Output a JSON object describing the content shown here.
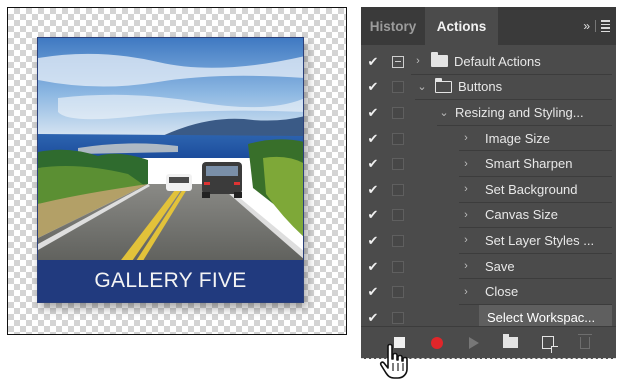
{
  "artwork": {
    "caption": "GALLERY FIVE",
    "band_color": "#213a7e"
  },
  "panel": {
    "tabs": [
      {
        "label": "History",
        "active": false
      },
      {
        "label": "Actions",
        "active": true
      }
    ],
    "menu_overflow": "»",
    "rows": [
      {
        "label": "Default Actions",
        "checked": true,
        "dialog_toggle": true,
        "expanded": false,
        "kind": "set",
        "indent": 0
      },
      {
        "label": "Buttons",
        "checked": true,
        "dialog_toggle": false,
        "expanded": true,
        "kind": "set",
        "indent": 0
      },
      {
        "label": "Resizing and Styling...",
        "checked": true,
        "dialog_toggle": false,
        "expanded": true,
        "kind": "action",
        "indent": 1
      },
      {
        "label": "Image Size",
        "checked": true,
        "dialog_toggle": false,
        "expanded": false,
        "kind": "command",
        "indent": 2
      },
      {
        "label": "Smart Sharpen",
        "checked": true,
        "dialog_toggle": false,
        "expanded": false,
        "kind": "command",
        "indent": 2
      },
      {
        "label": "Set Background",
        "checked": true,
        "dialog_toggle": false,
        "expanded": false,
        "kind": "command",
        "indent": 2
      },
      {
        "label": "Canvas Size",
        "checked": true,
        "dialog_toggle": false,
        "expanded": false,
        "kind": "command",
        "indent": 2
      },
      {
        "label": "Set Layer Styles ...",
        "checked": true,
        "dialog_toggle": false,
        "expanded": false,
        "kind": "command",
        "indent": 2
      },
      {
        "label": "Save",
        "checked": true,
        "dialog_toggle": false,
        "expanded": false,
        "kind": "command",
        "indent": 2
      },
      {
        "label": "Close",
        "checked": true,
        "dialog_toggle": false,
        "expanded": false,
        "kind": "command",
        "indent": 2
      },
      {
        "label": "Select Workspac...",
        "checked": true,
        "dialog_toggle": false,
        "expanded": null,
        "kind": "command",
        "indent": 2,
        "selected": true
      }
    ],
    "toolbar": {
      "buttons": [
        "stop-icon",
        "record-icon",
        "play-icon",
        "new-set-icon",
        "new-action-icon",
        "trash-icon"
      ],
      "record_color": "#e0262a"
    }
  }
}
